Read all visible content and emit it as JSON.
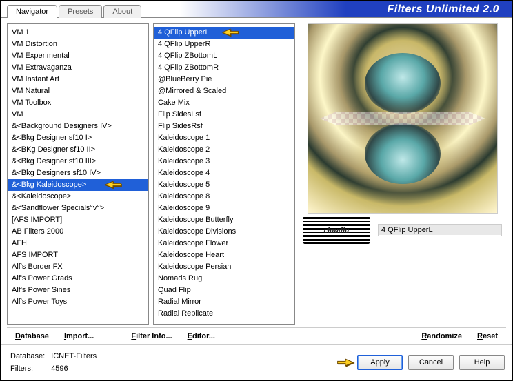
{
  "header": {
    "title": "Filters Unlimited 2.0",
    "tabs": [
      "Navigator",
      "Presets",
      "About"
    ],
    "active_tab": 0
  },
  "categories": {
    "selected_index": 13,
    "items": [
      "VM 1",
      "VM Distortion",
      "VM Experimental",
      "VM Extravaganza",
      "VM Instant Art",
      "VM Natural",
      "VM Toolbox",
      "VM",
      "&<Background Designers IV>",
      "&<Bkg Designer sf10 I>",
      "&<BKg Designer sf10 II>",
      "&<Bkg Designer sf10 III>",
      "&<Bkg Designers sf10 IV>",
      "&<Bkg Kaleidoscope>",
      "&<Kaleidoscope>",
      "&<Sandflower Specials°v°>",
      "[AFS IMPORT]",
      "AB Filters 2000",
      "AFH",
      "AFS IMPORT",
      "Alf's Border FX",
      "Alf's Power Grads",
      "Alf's Power Sines",
      "Alf's Power Toys"
    ]
  },
  "filters": {
    "selected_index": 0,
    "items": [
      "4 QFlip UpperL",
      "4 QFlip UpperR",
      "4 QFlip ZBottomL",
      "4 QFlip ZBottomR",
      "@BlueBerry Pie",
      "@Mirrored & Scaled",
      "Cake Mix",
      "Flip SidesLsf",
      "Flip SidesRsf",
      "Kaleidoscope 1",
      "Kaleidoscope 2",
      "Kaleidoscope 3",
      "Kaleidoscope 4",
      "Kaleidoscope 5",
      "Kaleidoscope 8",
      "Kaleidoscope 9",
      "Kaleidoscope Butterfly",
      "Kaleidoscope Divisions",
      "Kaleidoscope Flower",
      "Kaleidoscope Heart",
      "Kaleidoscope Persian",
      "Nomads Rug",
      "Quad Flip",
      "Radial Mirror",
      "Radial Replicate"
    ]
  },
  "preview": {
    "current_filter": "4 QFlip UpperL",
    "watermark_text": "claudia"
  },
  "link_buttons": {
    "database": "Database",
    "import": "Import...",
    "filter_info": "Filter Info...",
    "editor": "Editor...",
    "randomize": "Randomize",
    "reset": "Reset"
  },
  "footer": {
    "db_label": "Database:",
    "db_value": "ICNET-Filters",
    "filters_label": "Filters:",
    "filters_value": "4596",
    "apply": "Apply",
    "cancel": "Cancel",
    "help": "Help"
  }
}
